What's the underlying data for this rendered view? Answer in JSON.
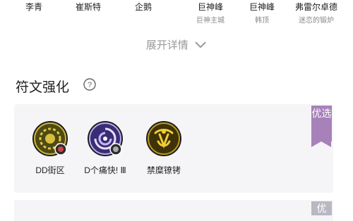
{
  "top_names": [
    {
      "name": "李青",
      "sub": ""
    },
    {
      "name": "崔斯特",
      "sub": ""
    },
    {
      "name": "企鹅",
      "sub": ""
    },
    {
      "name": "巨神峰",
      "sub": "巨神主城"
    },
    {
      "name": "巨神峰",
      "sub": "韩顶"
    },
    {
      "name": "弗雷尔卓德",
      "sub": "迷恋的锻炉"
    }
  ],
  "expand": {
    "label": "展开详情"
  },
  "rune_section": {
    "title": "符文强化",
    "badge": "优选",
    "runes": [
      {
        "label": "DD街区",
        "icon": "coin-rune-icon"
      },
      {
        "label": "D个痛快! Ⅲ",
        "icon": "spiral-rune-icon"
      },
      {
        "label": "禁糜镣铐",
        "icon": "shackle-rune-icon"
      }
    ]
  },
  "second_card": {
    "badge": "优"
  }
}
